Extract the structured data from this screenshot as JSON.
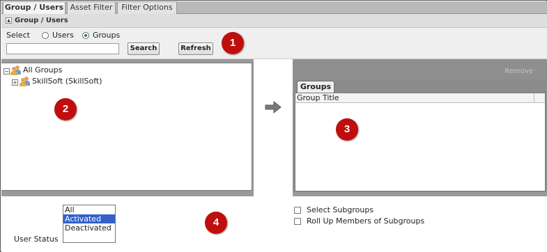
{
  "tabs": [
    {
      "label": "Group / Users",
      "active": true
    },
    {
      "label": "Asset Filter",
      "active": false
    },
    {
      "label": "Filter Options",
      "active": false
    }
  ],
  "section": {
    "title": "Group / Users",
    "toggle": "▲"
  },
  "select": {
    "label": "Select",
    "options": [
      {
        "label": "Users",
        "checked": false
      },
      {
        "label": "Groups",
        "checked": true
      }
    ],
    "search_value": "",
    "search_button": "Search",
    "refresh_button": "Refresh"
  },
  "tree": [
    {
      "label": "All Groups",
      "expander": "⊟"
    },
    {
      "label": "SkillSoft (SkillSoft)",
      "expander": "⊞"
    }
  ],
  "selected_panel": {
    "remove_label": "Remove",
    "tab_label": "Groups",
    "column_header": "Group Title"
  },
  "user_status": {
    "label": "User Status",
    "options": [
      {
        "label": "All",
        "selected": false
      },
      {
        "label": "Activated",
        "selected": true
      },
      {
        "label": "Deactivated",
        "selected": false
      }
    ]
  },
  "checkboxes": [
    {
      "label": "Select Subgroups",
      "checked": false
    },
    {
      "label": "Roll Up Members of Subgroups",
      "checked": false
    }
  ],
  "callouts": [
    "1",
    "2",
    "3",
    "4"
  ],
  "colors": {
    "callout": "#c00d0d",
    "selected_option": "#3360c9",
    "radio_dot": "#2f7d2f"
  }
}
